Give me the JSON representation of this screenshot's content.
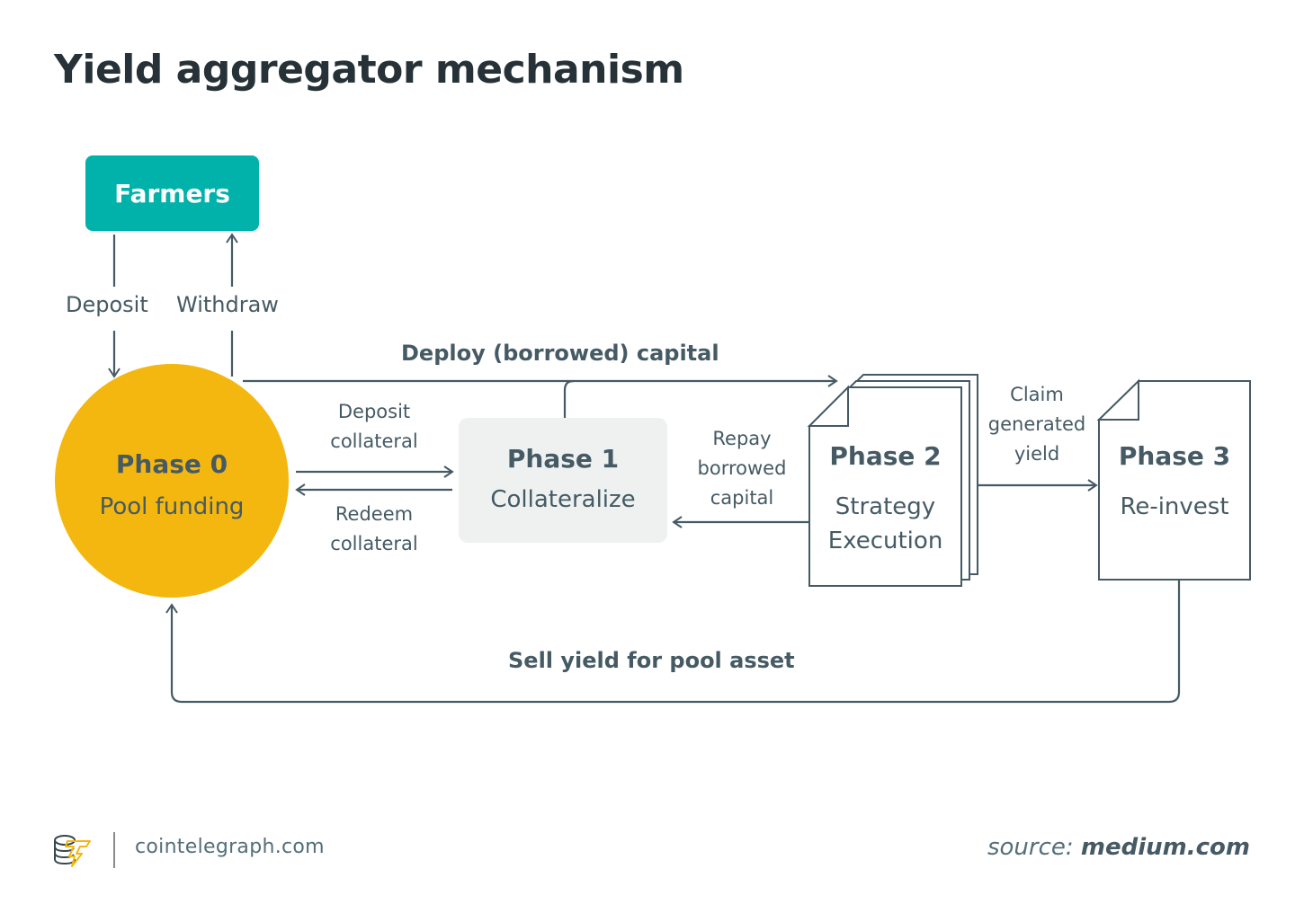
{
  "title": "Yield aggregator mechanism",
  "colors": {
    "farmers": "#00b2a9",
    "phase0": "#f4b70f",
    "phase1_bg": "#eff1f1",
    "line": "#455a64",
    "text_dark": "#263238"
  },
  "nodes": {
    "farmers": {
      "label": "Farmers"
    },
    "phase0": {
      "title": "Phase 0",
      "subtitle": "Pool funding"
    },
    "phase1": {
      "title": "Phase 1",
      "subtitle": "Collateralize"
    },
    "phase2": {
      "title": "Phase 2",
      "subtitle_line1": "Strategy",
      "subtitle_line2": "Execution"
    },
    "phase3": {
      "title": "Phase 3",
      "subtitle": "Re-invest"
    }
  },
  "edges": {
    "deposit": "Deposit",
    "withdraw": "Withdraw",
    "deploy": "Deploy (borrowed) capital",
    "deposit_collateral_1": "Deposit",
    "deposit_collateral_2": "collateral",
    "redeem_collateral_1": "Redeem",
    "redeem_collateral_2": "collateral",
    "repay_1": "Repay",
    "repay_2": "borrowed",
    "repay_3": "capital",
    "claim_1": "Claim",
    "claim_2": "generated",
    "claim_3": "yield",
    "sell": "Sell yield for pool asset"
  },
  "footer": {
    "logo_icon": "cointelegraph-logo-icon",
    "site": "cointelegraph.com",
    "source_label": "source:",
    "source_value": "medium.com"
  }
}
